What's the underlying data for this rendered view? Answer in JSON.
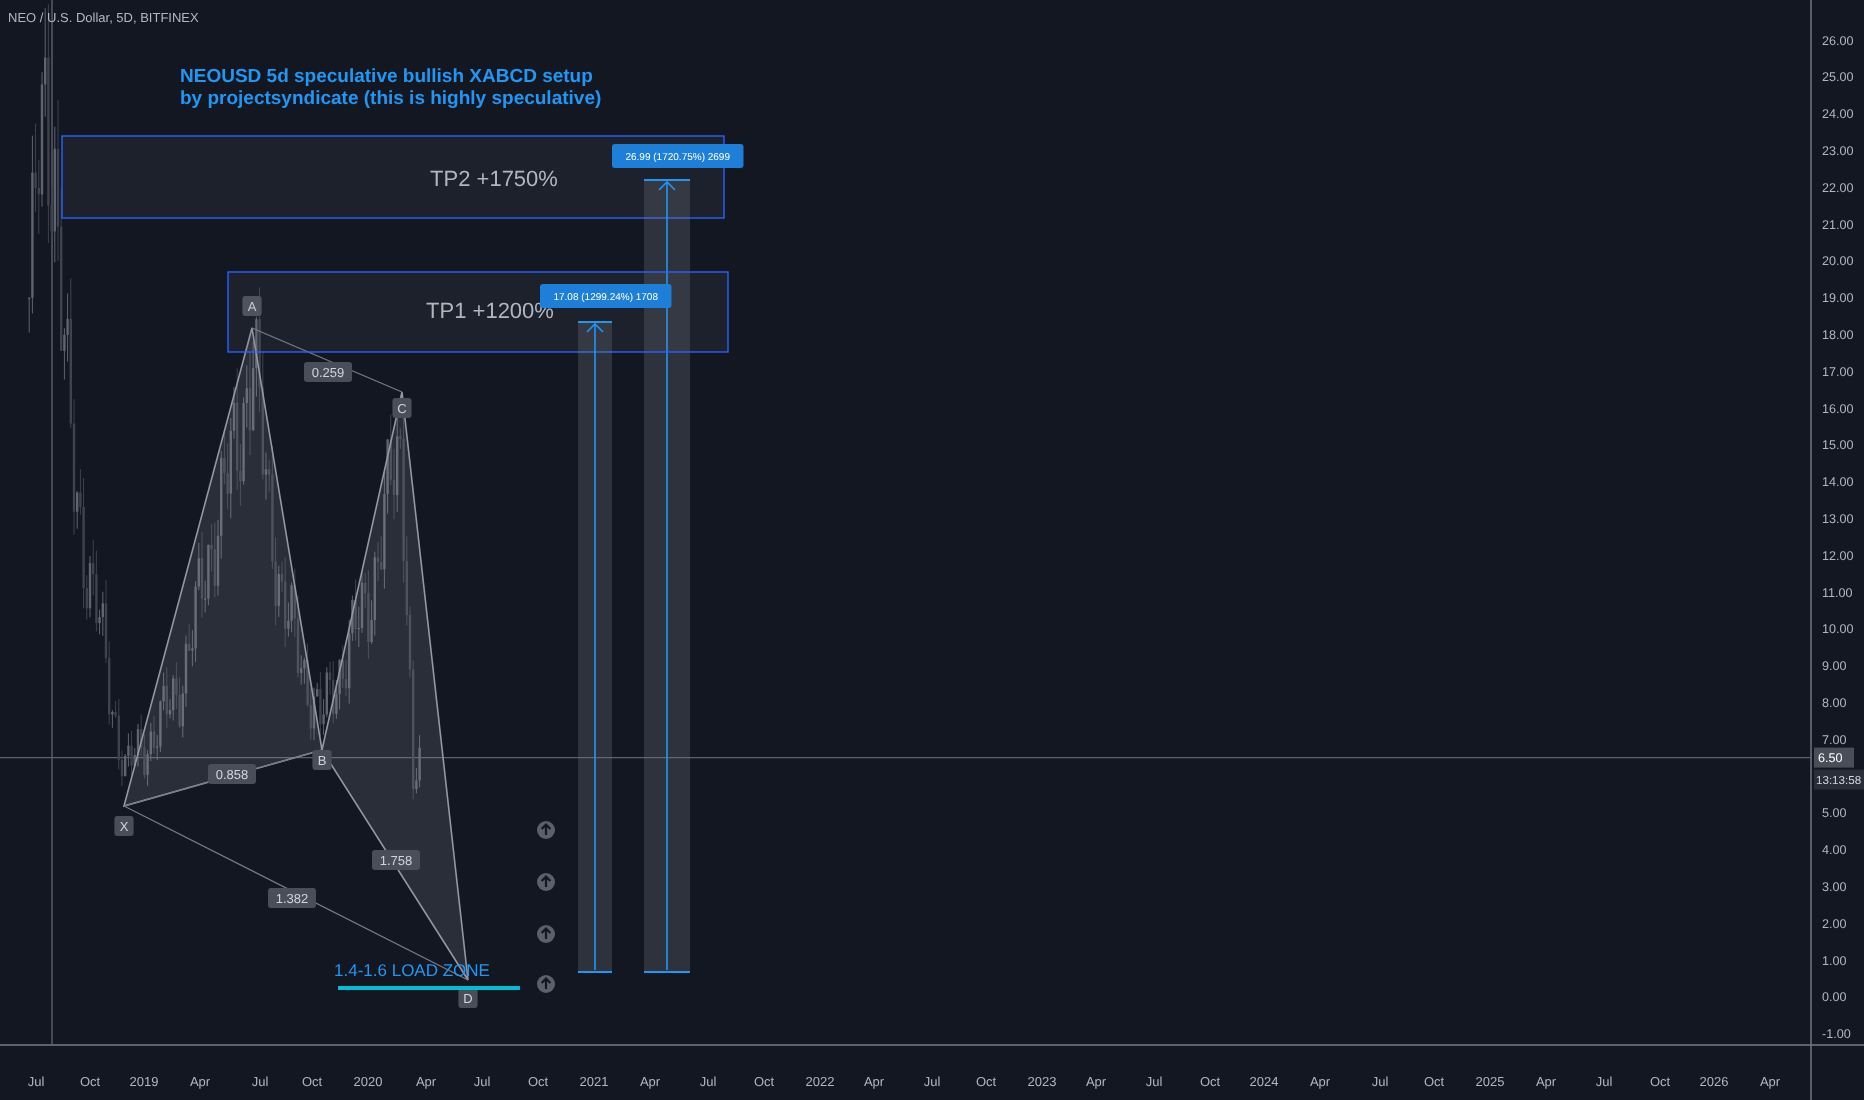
{
  "symbol": "NEO / U.S. Dollar, 5D, BITFINEX",
  "annotation": {
    "lines": [
      "NEOUSD 5d speculative bullish XABCD setup",
      "by projectsyndicate (this is highly speculative)"
    ]
  },
  "targets": [
    {
      "label": "TP2 +1750%",
      "measure": "26.99 (1720.75%) 2699"
    },
    {
      "label": "TP1 +1200%",
      "measure": "17.08 (1299.24%) 1708"
    }
  ],
  "pattern": {
    "points": [
      "X",
      "A",
      "B",
      "C",
      "D"
    ],
    "ratios": [
      "0.259",
      "0.858",
      "1.758",
      "1.382"
    ]
  },
  "load_zone": "1.4-1.6 LOAD ZONE",
  "price_axis": {
    "ticks": [
      "26.00",
      "25.00",
      "24.00",
      "23.00",
      "22.00",
      "21.00",
      "20.00",
      "19.00",
      "18.00",
      "17.00",
      "16.00",
      "15.00",
      "14.00",
      "13.00",
      "12.00",
      "11.00",
      "10.00",
      "9.00",
      "8.00",
      "7.00",
      "5.00",
      "4.00",
      "3.00",
      "2.00",
      "1.00",
      "0.00",
      "-1.00"
    ],
    "current_price": "6.50",
    "countdown": "13:13:58"
  },
  "time_axis": {
    "ticks": [
      "Jul",
      "Oct",
      "2019",
      "Apr",
      "Jul",
      "Oct",
      "2020",
      "Apr",
      "Jul",
      "Oct",
      "2021",
      "Apr",
      "Jul",
      "Oct",
      "2022",
      "Apr",
      "Jul",
      "Oct",
      "2023",
      "Apr",
      "Jul",
      "Oct",
      "2024",
      "Apr",
      "Jul",
      "Oct",
      "2025",
      "Apr",
      "Jul",
      "Oct",
      "2026",
      "Apr"
    ]
  }
}
